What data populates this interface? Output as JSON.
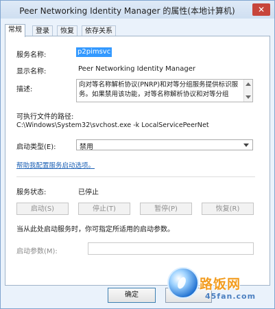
{
  "window": {
    "title": "Peer Networking Identity Manager 的属性(本地计算机)",
    "close_glyph": "✕"
  },
  "tabs": [
    {
      "label": "常规",
      "active": true
    },
    {
      "label": "登录",
      "active": false
    },
    {
      "label": "恢复",
      "active": false
    },
    {
      "label": "依存关系",
      "active": false
    }
  ],
  "general": {
    "service_name_label": "服务名称:",
    "service_name": "p2pimsvc",
    "display_name_label": "显示名称:",
    "display_name": "Peer Networking Identity Manager",
    "description_label": "描述:",
    "description": "向对等名称解析协议(PNRP)和对等分组服务提供标识服务。如果禁用该功能，对等名称解析协议和对等分组",
    "exe_path_label": "可执行文件的路径:",
    "exe_path": "C:\\Windows\\System32\\svchost.exe -k LocalServicePeerNet",
    "startup_type_label": "启动类型(E):",
    "startup_type": "禁用",
    "help_link": "帮助我配置服务启动选项。",
    "status_label": "服务状态:",
    "status": "已停止",
    "buttons": {
      "start": "启动(S)",
      "stop": "停止(T)",
      "pause": "暂停(P)",
      "resume": "恢复(R)"
    },
    "hint": "当从此处启动服务时，你可指定所适用的启动参数。",
    "params_label": "启动参数(M):",
    "params_value": ""
  },
  "dialog_buttons": {
    "ok": "确定",
    "cancel": ""
  },
  "watermark": {
    "text": "路饭网",
    "site": "45fan.com"
  }
}
